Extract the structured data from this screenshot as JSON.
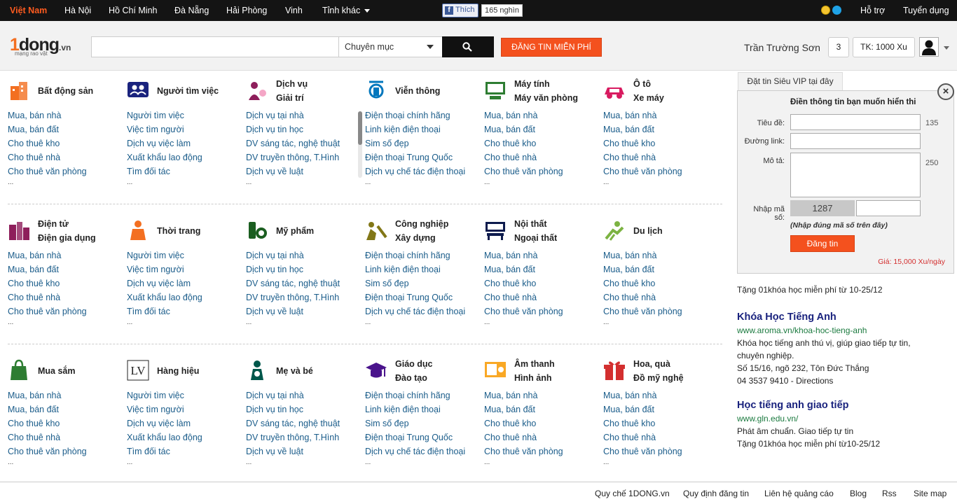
{
  "topbar": {
    "cities": [
      "Việt Nam",
      "Hà Nội",
      "Hồ Chí Minh",
      "Đà Nẵng",
      "Hải Phòng",
      "Vinh",
      "Tỉnh khác"
    ],
    "fb_like": "Thích",
    "fb_count": "165 nghìn",
    "support": "Hỗ trợ",
    "jobs": "Tuyển dụng"
  },
  "header": {
    "logo_one": "1",
    "logo_dong": "dong",
    "logo_vn": ".vn",
    "logo_tagline": "mạng rao vặt",
    "search_placeholder": "",
    "category_select": "Chuyên mục",
    "post_free": "ĐĂNG TIN MIỄN PHÍ",
    "user_name": "Trần Trường Sơn",
    "notify_count": "3",
    "balance": "TK: 1000 Xu"
  },
  "grid": {
    "rows": [
      [
        {
          "title1": "Bất động sản",
          "title2": "",
          "icon": "building-icon",
          "color": "#f36f21",
          "links": [
            "Mua, bán nhà",
            "Mua, bán đất",
            "Cho thuê kho",
            "Cho thuê nhà",
            "Cho thuê văn phòng"
          ]
        },
        {
          "title1": "Người tìm việc",
          "title2": "",
          "icon": "people-icon",
          "color": "#1a237e",
          "links": [
            "Người tìm việc",
            "Việc tìm người",
            "Dịch vụ việc làm",
            "Xuất khẩu lao động",
            "Tìm đối tác"
          ]
        },
        {
          "title1": "Dịch vụ",
          "title2": "Giải trí",
          "icon": "entertainment-icon",
          "color": "#8e1e5b",
          "links": [
            "Dịch vụ tại nhà",
            "Dịch vụ tin học",
            "DV sáng tác, nghệ thuật",
            "DV truyền thông, T.Hình",
            "Dịch vụ về luật"
          ]
        },
        {
          "title1": "Viễn thông",
          "title2": "",
          "icon": "telecom-icon",
          "color": "#0277bd",
          "links": [
            "Điện thoại chính hãng",
            "Linh kiện điện thoại",
            "Sim số đẹp",
            "Điện thoại Trung Quốc",
            "Dịch vụ chế tác điện thoại"
          ]
        },
        {
          "title1": "Máy tính",
          "title2": "Máy văn phòng",
          "icon": "computer-icon",
          "color": "#2e7d32",
          "links": [
            "Mua, bán nhà",
            "Mua, bán đất",
            "Cho thuê kho",
            "Cho thuê nhà",
            "Cho thuê văn phòng"
          ]
        },
        {
          "title1": "Ô tô",
          "title2": "Xe máy",
          "icon": "car-icon",
          "color": "#d81b60",
          "links": [
            "Mua, bán nhà",
            "Mua, bán đất",
            "Cho thuê kho",
            "Cho thuê nhà",
            "Cho thuê văn phòng"
          ]
        }
      ],
      [
        {
          "title1": "Điện tử",
          "title2": "Điện gia dụng",
          "icon": "electronics-icon",
          "color": "#8e1e5b",
          "links": [
            "Mua, bán nhà",
            "Mua, bán đất",
            "Cho thuê kho",
            "Cho thuê nhà",
            "Cho thuê văn phòng"
          ]
        },
        {
          "title1": "Thời trang",
          "title2": "",
          "icon": "fashion-icon",
          "color": "#f36f21",
          "links": [
            "Người tìm việc",
            "Việc tìm người",
            "Dịch vụ việc làm",
            "Xuất khẩu lao động",
            "Tìm đối tác"
          ]
        },
        {
          "title1": "Mỹ phẩm",
          "title2": "",
          "icon": "cosmetics-icon",
          "color": "#1b5e20",
          "links": [
            "Dịch vụ tại nhà",
            "Dịch vụ tin học",
            "DV sáng tác, nghệ thuật",
            "DV truyền thông, T.Hình",
            "Dịch vụ về luật"
          ]
        },
        {
          "title1": "Công nghiệp",
          "title2": "Xây dựng",
          "icon": "construction-icon",
          "color": "#827717",
          "links": [
            "Điện thoại chính hãng",
            "Linh kiện điện thoại",
            "Sim số đẹp",
            "Điện thoại Trung Quốc",
            "Dịch vụ chế tác điện thoại"
          ]
        },
        {
          "title1": "Nội thất",
          "title2": "Ngoại thất",
          "icon": "furniture-icon",
          "color": "#0d1b4d",
          "links": [
            "Mua, bán nhà",
            "Mua, bán đất",
            "Cho thuê kho",
            "Cho thuê nhà",
            "Cho thuê văn phòng"
          ]
        },
        {
          "title1": "Du lịch",
          "title2": "",
          "icon": "travel-icon",
          "color": "#7cb342",
          "links": [
            "Mua, bán nhà",
            "Mua, bán đất",
            "Cho thuê kho",
            "Cho thuê nhà",
            "Cho thuê văn phòng"
          ]
        }
      ],
      [
        {
          "title1": "Mua sắm",
          "title2": "",
          "icon": "shopping-bag-icon",
          "color": "#2e7d32",
          "links": [
            "Mua, bán nhà",
            "Mua, bán đất",
            "Cho thuê kho",
            "Cho thuê nhà",
            "Cho thuê văn phòng"
          ]
        },
        {
          "title1": "Hàng hiệu",
          "title2": "",
          "icon": "brand-icon",
          "color": "#222222",
          "links": [
            "Người tìm việc",
            "Việc tìm người",
            "Dịch vụ việc làm",
            "Xuất khẩu lao động",
            "Tìm đối tác"
          ]
        },
        {
          "title1": "Mẹ và bé",
          "title2": "",
          "icon": "mother-baby-icon",
          "color": "#00574b",
          "links": [
            "Dịch vụ tại nhà",
            "Dịch vụ tin học",
            "DV sáng tác, nghệ thuật",
            "DV truyền thông, T.Hình",
            "Dịch vụ về luật"
          ]
        },
        {
          "title1": "Giáo dục",
          "title2": "Đào tạo",
          "icon": "graduation-icon",
          "color": "#4a148c",
          "links": [
            "Điện thoại chính hãng",
            "Linh kiện điện thoại",
            "Sim số đẹp",
            "Điện thoại Trung Quốc",
            "Dịch vụ chế tác điện thoại"
          ]
        },
        {
          "title1": "Âm thanh",
          "title2": "Hình ảnh",
          "icon": "audio-video-icon",
          "color": "#f9a825",
          "links": [
            "Mua, bán nhà",
            "Mua, bán đất",
            "Cho thuê kho",
            "Cho thuê nhà",
            "Cho thuê văn phòng"
          ]
        },
        {
          "title1": "Hoa, quà",
          "title2": "Đồ mỹ nghệ",
          "icon": "gift-icon",
          "color": "#d32f2f",
          "links": [
            "Mua, bán nhà",
            "Mua, bán đất",
            "Cho thuê kho",
            "Cho thuê nhà",
            "Cho thuê văn phòng"
          ]
        }
      ]
    ],
    "more": "..."
  },
  "vip": {
    "tab": "Đặt tin Siêu VIP tại đây",
    "close": "×",
    "heading": "Điền thông tin bạn muốn hiển thi",
    "title_label": "Tiêu đề:",
    "title_limit": "135",
    "link_label": "Đường link:",
    "desc_label": "Mô tả:",
    "desc_limit": "250",
    "captcha_label": "Nhập mã số:",
    "captcha_code": "1287",
    "captcha_note": "(Nhập đúng mã số trên đây)",
    "submit": "Đăng tin",
    "price": "Giá: 15,000 Xu/ngày"
  },
  "promo": {
    "line": "Tặng 01khóa học miễn phí từ 10-25/12",
    "ads": [
      {
        "title": "Khóa Học Tiếng Anh",
        "url": "www.aroma.vn/khoa-hoc-tieng-anh",
        "lines": [
          "Khóa học tiếng anh thú vị, giúp giao tiếp tự tin,",
          "chuyên nghiệp.",
          "Số 15/16, ngõ 232, Tôn Đức Thắng",
          "04 3537 9410 - Directions"
        ]
      },
      {
        "title": "Học tiếng anh giao tiếp",
        "url": "www.gln.edu.vn/",
        "lines": [
          "Phát âm chuẩn. Giao tiếp tự tin",
          "Tặng 01khóa học miễn phí từ10-25/12"
        ]
      }
    ]
  },
  "footer": [
    "Quy chế 1DONG.vn",
    "Quy định đăng tin",
    "Liên hệ quảng cáo",
    "Blog",
    "Rss",
    "Site map"
  ]
}
